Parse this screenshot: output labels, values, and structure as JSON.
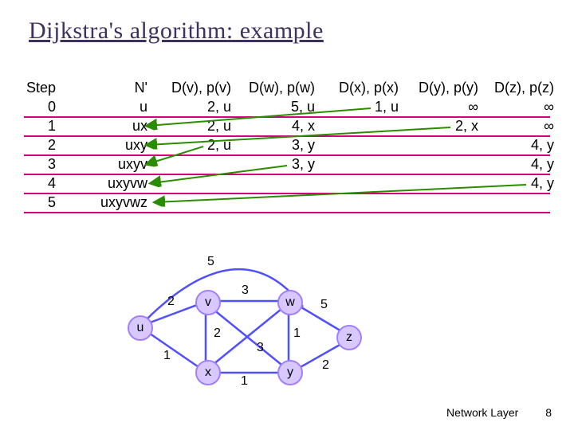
{
  "title": "Dijkstra's algorithm: example",
  "table": {
    "headers": {
      "step": "Step",
      "n": "N'",
      "dv": "D(v), p(v)",
      "dw": "D(w), p(w)",
      "dx": "D(x), p(x)",
      "dy": "D(y), p(y)",
      "dz": "D(z), p(z)"
    },
    "rows": [
      {
        "step": "0",
        "n": "u",
        "dv": "2, u",
        "dw": "5, u",
        "dx": "1, u",
        "dy": "∞",
        "dz": "∞"
      },
      {
        "step": "1",
        "n": "ux",
        "dv": "2, u",
        "dw": "4, x",
        "dx": "",
        "dy": "2, x",
        "dz": "∞"
      },
      {
        "step": "2",
        "n": "uxy",
        "dv": "2, u",
        "dw": "3, y",
        "dx": "",
        "dy": "",
        "dz": "4, y"
      },
      {
        "step": "3",
        "n": "uxyv",
        "dv": "",
        "dw": "3, y",
        "dx": "",
        "dy": "",
        "dz": "4, y"
      },
      {
        "step": "4",
        "n": "uxyvw",
        "dv": "",
        "dw": "",
        "dx": "",
        "dy": "",
        "dz": "4, y"
      },
      {
        "step": "5",
        "n": "uxyvwz",
        "dv": "",
        "dw": "",
        "dx": "",
        "dy": "",
        "dz": ""
      }
    ]
  },
  "graph": {
    "nodes": {
      "u": "u",
      "v": "v",
      "w": "w",
      "x": "x",
      "y": "y",
      "z": "z"
    },
    "edge_weights": {
      "uv": "2",
      "ux": "1",
      "uw": "5",
      "vx": "2",
      "vw": "3",
      "xw": "3",
      "xy": "1",
      "wy": "1",
      "wz": "5",
      "yz": "2"
    }
  },
  "footer": {
    "section": "Network Layer",
    "page": "8"
  }
}
